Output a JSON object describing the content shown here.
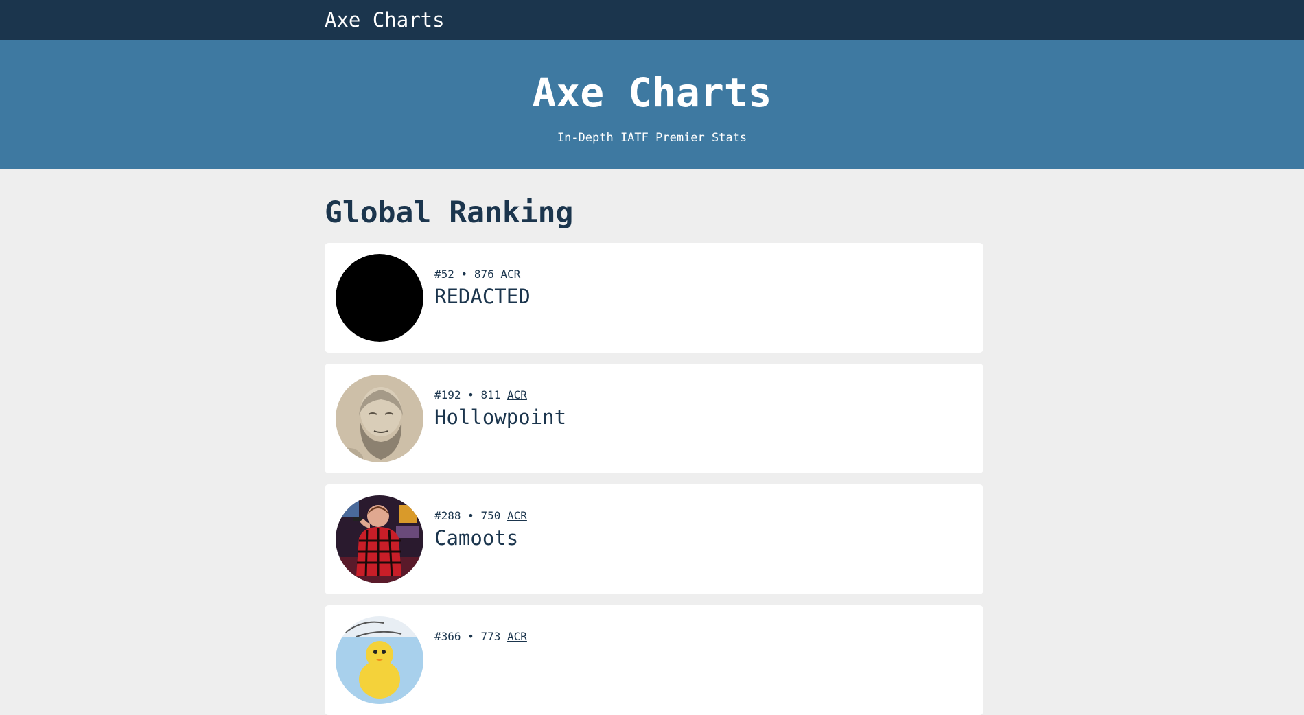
{
  "nav": {
    "brand": "Axe Charts"
  },
  "hero": {
    "title": "Axe Charts",
    "subtitle": "In-Depth IATF Premier Stats"
  },
  "main": {
    "section_title": "Global Ranking",
    "players": [
      {
        "rank": "#52",
        "separator": "•",
        "rating": "876",
        "rating_label": "ACR",
        "name": "REDACTED",
        "avatar_icon": "black-circle-avatar"
      },
      {
        "rank": "#192",
        "separator": "•",
        "rating": "811",
        "rating_label": "ACR",
        "name": "Hollowpoint",
        "avatar_icon": "bearded-man-sketch-avatar"
      },
      {
        "rank": "#288",
        "separator": "•",
        "rating": "750",
        "rating_label": "ACR",
        "name": "Camoots",
        "avatar_icon": "man-red-plaid-shirt-avatar"
      },
      {
        "rank": "#366",
        "separator": "•",
        "rating": "773",
        "rating_label": "ACR",
        "name": "",
        "avatar_icon": "cartoon-duck-avatar"
      }
    ]
  },
  "colors": {
    "topbar": "#1b354d",
    "hero": "#3e79a1",
    "page_bg": "#eeeeee",
    "card_bg": "#ffffff",
    "text_dark": "#1b354d"
  }
}
